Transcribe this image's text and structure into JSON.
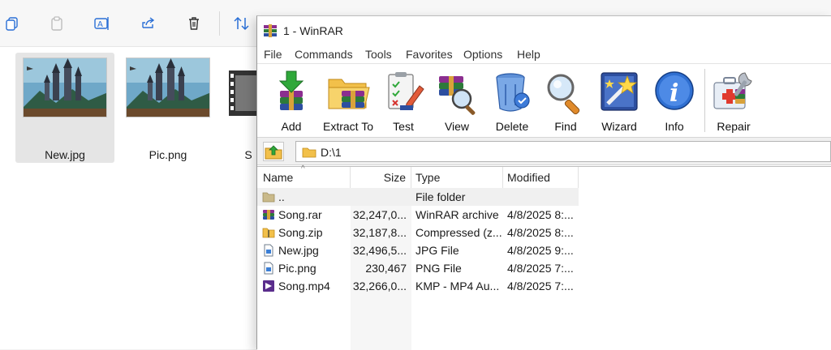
{
  "explorer": {
    "toolbar_icons": [
      "copy-icon",
      "paste-icon",
      "rename-icon",
      "share-icon",
      "delete-icon",
      "sort-icon"
    ],
    "thumbnails": [
      {
        "name": "New.jpg",
        "selected": true
      },
      {
        "name": "Pic.png",
        "selected": false
      },
      {
        "name": "S",
        "selected": false
      }
    ]
  },
  "winrar": {
    "title": "1 - WinRAR",
    "menu": [
      "File",
      "Commands",
      "Tools",
      "Favorites",
      "Options",
      "Help"
    ],
    "toolbar": [
      {
        "label": "Add",
        "icon": "add-icon"
      },
      {
        "label": "Extract To",
        "icon": "extract-to-icon"
      },
      {
        "label": "Test",
        "icon": "test-icon"
      },
      {
        "label": "View",
        "icon": "view-icon"
      },
      {
        "label": "Delete",
        "icon": "delete-icon"
      },
      {
        "label": "Find",
        "icon": "find-icon"
      },
      {
        "label": "Wizard",
        "icon": "wizard-icon"
      },
      {
        "label": "Info",
        "icon": "info-icon"
      },
      {
        "label": "Repair",
        "icon": "repair-icon"
      }
    ],
    "path": "D:\\1",
    "columns": {
      "name": "Name",
      "size": "Size",
      "type": "Type",
      "modified": "Modified"
    },
    "files": [
      {
        "name": "..",
        "size": "",
        "type": "File folder",
        "modified": "",
        "icon": "folder-icon"
      },
      {
        "name": "Song.rar",
        "size": "32,247,0...",
        "type": "WinRAR archive",
        "modified": "4/8/2025 8:...",
        "icon": "rar-file-icon"
      },
      {
        "name": "Song.zip",
        "size": "32,187,8...",
        "type": "Compressed (z...",
        "modified": "4/8/2025 8:...",
        "icon": "zip-file-icon"
      },
      {
        "name": "New.jpg",
        "size": "32,496,5...",
        "type": "JPG File",
        "modified": "4/8/2025 9:...",
        "icon": "jpg-file-icon"
      },
      {
        "name": "Pic.png",
        "size": "230,467",
        "type": "PNG File",
        "modified": "4/8/2025 7:...",
        "icon": "png-file-icon"
      },
      {
        "name": "Song.mp4",
        "size": "32,266,0...",
        "type": "KMP - MP4 Au...",
        "modified": "4/8/2025 7:...",
        "icon": "mp4-file-icon"
      }
    ]
  }
}
